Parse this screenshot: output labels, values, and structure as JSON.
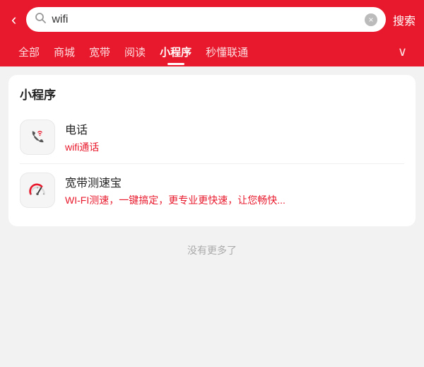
{
  "header": {
    "back_label": "‹",
    "search_value": "wifi",
    "clear_icon": "×",
    "submit_label": "搜索"
  },
  "tabs": [
    {
      "id": "all",
      "label": "全部",
      "active": false
    },
    {
      "id": "mall",
      "label": "商城",
      "active": false
    },
    {
      "id": "broadband",
      "label": "宽带",
      "active": false
    },
    {
      "id": "reading",
      "label": "阅读",
      "active": false
    },
    {
      "id": "miniapp",
      "label": "小程序",
      "active": true
    },
    {
      "id": "seckill",
      "label": "秒懂联通",
      "active": false
    }
  ],
  "more_label": "∨",
  "section": {
    "title": "小程序",
    "items": [
      {
        "id": "phone-call",
        "name": "电话",
        "desc": "wifi通话"
      },
      {
        "id": "speed-test",
        "name": "宽带测速宝",
        "desc": "WI-FI测速，一键搞定，更专业更快速，让您畅快..."
      }
    ]
  },
  "no_more_label": "没有更多了"
}
